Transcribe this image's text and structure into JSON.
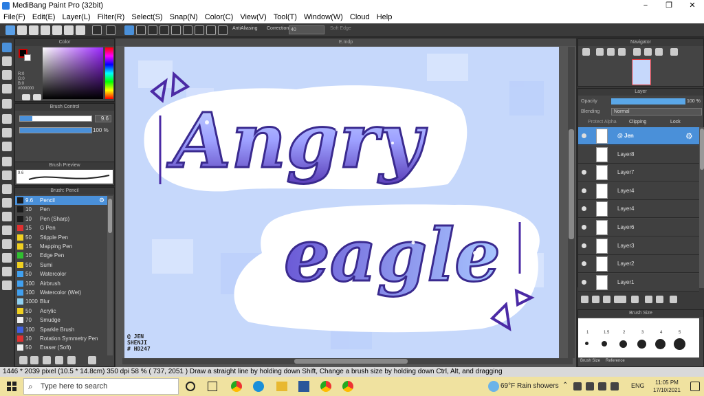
{
  "window": {
    "title": "MediBang Paint Pro (32bit)",
    "minimize": "−",
    "maximize": "❐",
    "close": "✕"
  },
  "menu": [
    "File(F)",
    "Edit(E)",
    "Layer(L)",
    "Filter(R)",
    "Select(S)",
    "Snap(N)",
    "Color(C)",
    "View(V)",
    "Tool(T)",
    "Window(W)",
    "Cloud",
    "Help"
  ],
  "toolbar": {
    "antialiasing": "AntiAliasing",
    "correction_label": "Correction",
    "correction_value": "40",
    "soft_edge": "Soft Edge"
  },
  "panels": {
    "color": {
      "title": "Color",
      "r": "R:0",
      "g": "G:0",
      "b": "B:0",
      "hex": "#000000"
    },
    "brush_control": {
      "title": "Brush Control",
      "size": "9.6",
      "opacity": "100 %"
    },
    "brush_preview": {
      "title": "Brush Preview",
      "size": "9.6"
    },
    "brush_list": {
      "title": "Brush: Pencil"
    }
  },
  "brushes": [
    {
      "size": "9.6",
      "name": "Pencil",
      "color": "#1a1a1a",
      "selected": true
    },
    {
      "size": "10",
      "name": "Pen",
      "color": "#1a1a1a"
    },
    {
      "size": "10",
      "name": "Pen (Sharp)",
      "color": "#1a1a1a"
    },
    {
      "size": "15",
      "name": "G Pen",
      "color": "#e03030"
    },
    {
      "size": "50",
      "name": "Stipple Pen",
      "color": "#f0d020"
    },
    {
      "size": "15",
      "name": "Mapping Pen",
      "color": "#f0d020"
    },
    {
      "size": "10",
      "name": "Edge Pen",
      "color": "#30c030"
    },
    {
      "size": "50",
      "name": "Sumi",
      "color": "#f0d020"
    },
    {
      "size": "50",
      "name": "Watercolor",
      "color": "#40a0f0"
    },
    {
      "size": "100",
      "name": "Airbrush",
      "color": "#40a0f0"
    },
    {
      "size": "100",
      "name": "Watercolor (Wet)",
      "color": "#40a0f0"
    },
    {
      "size": "1000",
      "name": "Blur",
      "color": "#90d0f0"
    },
    {
      "size": "50",
      "name": "Acrylic",
      "color": "#f0d020"
    },
    {
      "size": "70",
      "name": "Smudge",
      "color": "#f0f0f0"
    },
    {
      "size": "100",
      "name": "Sparkle Brush",
      "color": "#4060e0"
    },
    {
      "size": "10",
      "name": "Rotation Symmetry Pen",
      "color": "#e03030"
    },
    {
      "size": "50",
      "name": "Eraser (Soft)",
      "color": "#f0f0f0"
    }
  ],
  "canvas": {
    "doc_title": "E.mdp",
    "line1": "Angry",
    "line2": "eagle",
    "signature": [
      "@ JEN",
      "SHENJI",
      "# HD247"
    ]
  },
  "navigator": {
    "title": "Navigator"
  },
  "layer_panel": {
    "title": "Layer",
    "opacity_label": "Opacity",
    "opacity_value": "100 %",
    "blending_label": "Blending",
    "blending_value": "Normal",
    "protect_alpha": "Protect Alpha",
    "clipping": "Clipping",
    "lock": "Lock"
  },
  "layers": [
    {
      "name": "@ Jen",
      "selected": true,
      "visible": true
    },
    {
      "name": "Layer8",
      "visible": false
    },
    {
      "name": "Layer7",
      "visible": true
    },
    {
      "name": "Layer4",
      "visible": true
    },
    {
      "name": "Layer4",
      "visible": true
    },
    {
      "name": "Layer6",
      "visible": true
    },
    {
      "name": "Layer3",
      "visible": true
    },
    {
      "name": "Layer2",
      "visible": true
    },
    {
      "name": "Layer1",
      "visible": true
    }
  ],
  "brush_size_panel": {
    "title": "Brush Size",
    "tab1": "Brush Size",
    "tab2": "Reference",
    "sizes": [
      "1",
      "1.5",
      "2",
      "3",
      "4",
      "5"
    ]
  },
  "status": "1446 * 2039 pixel   (10.5 * 14.8cm)   350 dpi   58 %   ( 737, 2051 )   Draw a straight line by holding down Shift, Change a brush size by holding down Ctrl, Alt, and dragging",
  "taskbar": {
    "search_placeholder": "Type here to search",
    "weather": "69°F  Rain showers",
    "lang": "ENG",
    "time": "11:05 PM",
    "date": "17/10/2021"
  }
}
